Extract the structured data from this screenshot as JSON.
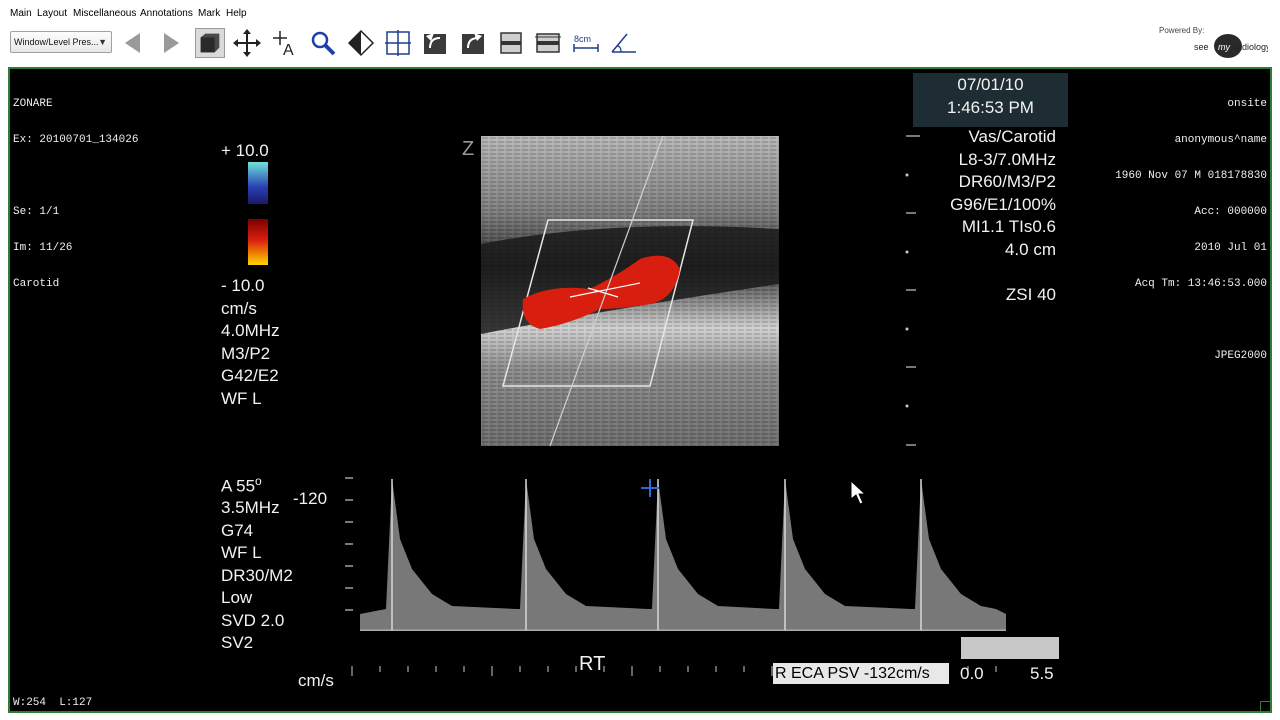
{
  "menu": [
    "Main",
    "Layout",
    "Miscellaneous",
    "Annotations",
    "Mark",
    "Help"
  ],
  "toolbar": {
    "window_level_preset": "Window/Level Pres...",
    "measure_label": "8cm",
    "powered_by": "Powered By:",
    "logo_text": "seemyradiology",
    "icons": [
      "prev-arrow-icon",
      "next-arrow-icon",
      "cube-icon",
      "pan-icon",
      "text-annotation-icon",
      "zoom-icon",
      "invert-icon",
      "crosshair-icon",
      "rotate-left-icon",
      "rotate-right-icon",
      "flip-vertical-icon",
      "flip-horizontal-icon",
      "ruler-icon",
      "angle-icon"
    ]
  },
  "overlay": {
    "top_left": [
      "ZONARE",
      "Ex: 20100701_134026",
      "",
      "Se: 1/1",
      "Im: 11/26",
      "Carotid"
    ],
    "top_right": [
      "onsite",
      "anonymous^name",
      "1960 Nov 07 M 018178830",
      "Acc: 000000",
      "2010 Jul 01",
      "Acq Tm: 13:46:53.000",
      "",
      "JPEG2000"
    ],
    "bottom_left": "W:254  L:127"
  },
  "ultrasound": {
    "date": "07/01/10",
    "time": "1:46:53 PM",
    "right_params": [
      "Vas/Carotid",
      "L8-3/7.0MHz",
      "DR60/M3/P2",
      "G96/E1/100%",
      "MI1.1  TIs0.6",
      "4.0 cm",
      "",
      "ZSI 40"
    ],
    "color_scale_top": "+ 10.0",
    "color_params": [
      "- 10.0",
      "cm/s",
      "4.0MHz",
      "M3/P2",
      "G42/E2",
      "WF L"
    ],
    "angle_prefix": "A 55",
    "angle_degree": "o",
    "doppler_params": [
      "3.5MHz",
      "G74",
      "WF L",
      "DR30/M2",
      "Low",
      "SVD 2.0",
      "SV2"
    ],
    "doppler_scale_top": "-120",
    "doppler_unit": "cm/s",
    "side_label": "RT",
    "psv_label": "R ECA PSV -132cm/s",
    "time_scale_left": "0.0",
    "time_scale_right": "5.5",
    "colors": {
      "viewer_border": "#2e7d32",
      "flow_red": "#d81e0e",
      "date_box": "#1e2c34"
    }
  }
}
